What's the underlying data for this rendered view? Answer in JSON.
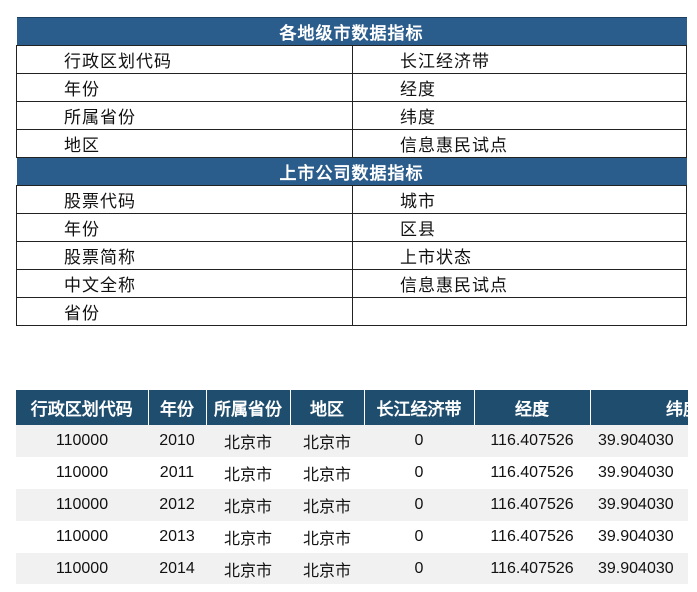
{
  "indicators": {
    "city_section_title": "各地级市数据指标",
    "city_rows": [
      [
        "行政区划代码",
        "长江经济带"
      ],
      [
        "年份",
        "经度"
      ],
      [
        "所属省份",
        "纬度"
      ],
      [
        "地区",
        "信息惠民试点"
      ]
    ],
    "company_section_title": "上市公司数据指标",
    "company_rows": [
      [
        "股票代码",
        "城市"
      ],
      [
        "年份",
        "区县"
      ],
      [
        "股票简称",
        "上市状态"
      ],
      [
        "中文全称",
        "信息惠民试点"
      ],
      [
        "省份",
        ""
      ]
    ]
  },
  "data_table": {
    "headers": [
      "行政区划代码",
      "年份",
      "所属省份",
      "地区",
      "长江经济带",
      "经度",
      "纬度"
    ],
    "rows": [
      [
        "110000",
        "2010",
        "北京市",
        "北京市",
        "0",
        "116.407526",
        "39.904030"
      ],
      [
        "110000",
        "2011",
        "北京市",
        "北京市",
        "0",
        "116.407526",
        "39.904030"
      ],
      [
        "110000",
        "2012",
        "北京市",
        "北京市",
        "0",
        "116.407526",
        "39.904030"
      ],
      [
        "110000",
        "2013",
        "北京市",
        "北京市",
        "0",
        "116.407526",
        "39.904030"
      ],
      [
        "110000",
        "2014",
        "北京市",
        "北京市",
        "0",
        "116.407526",
        "39.904030"
      ]
    ]
  }
}
